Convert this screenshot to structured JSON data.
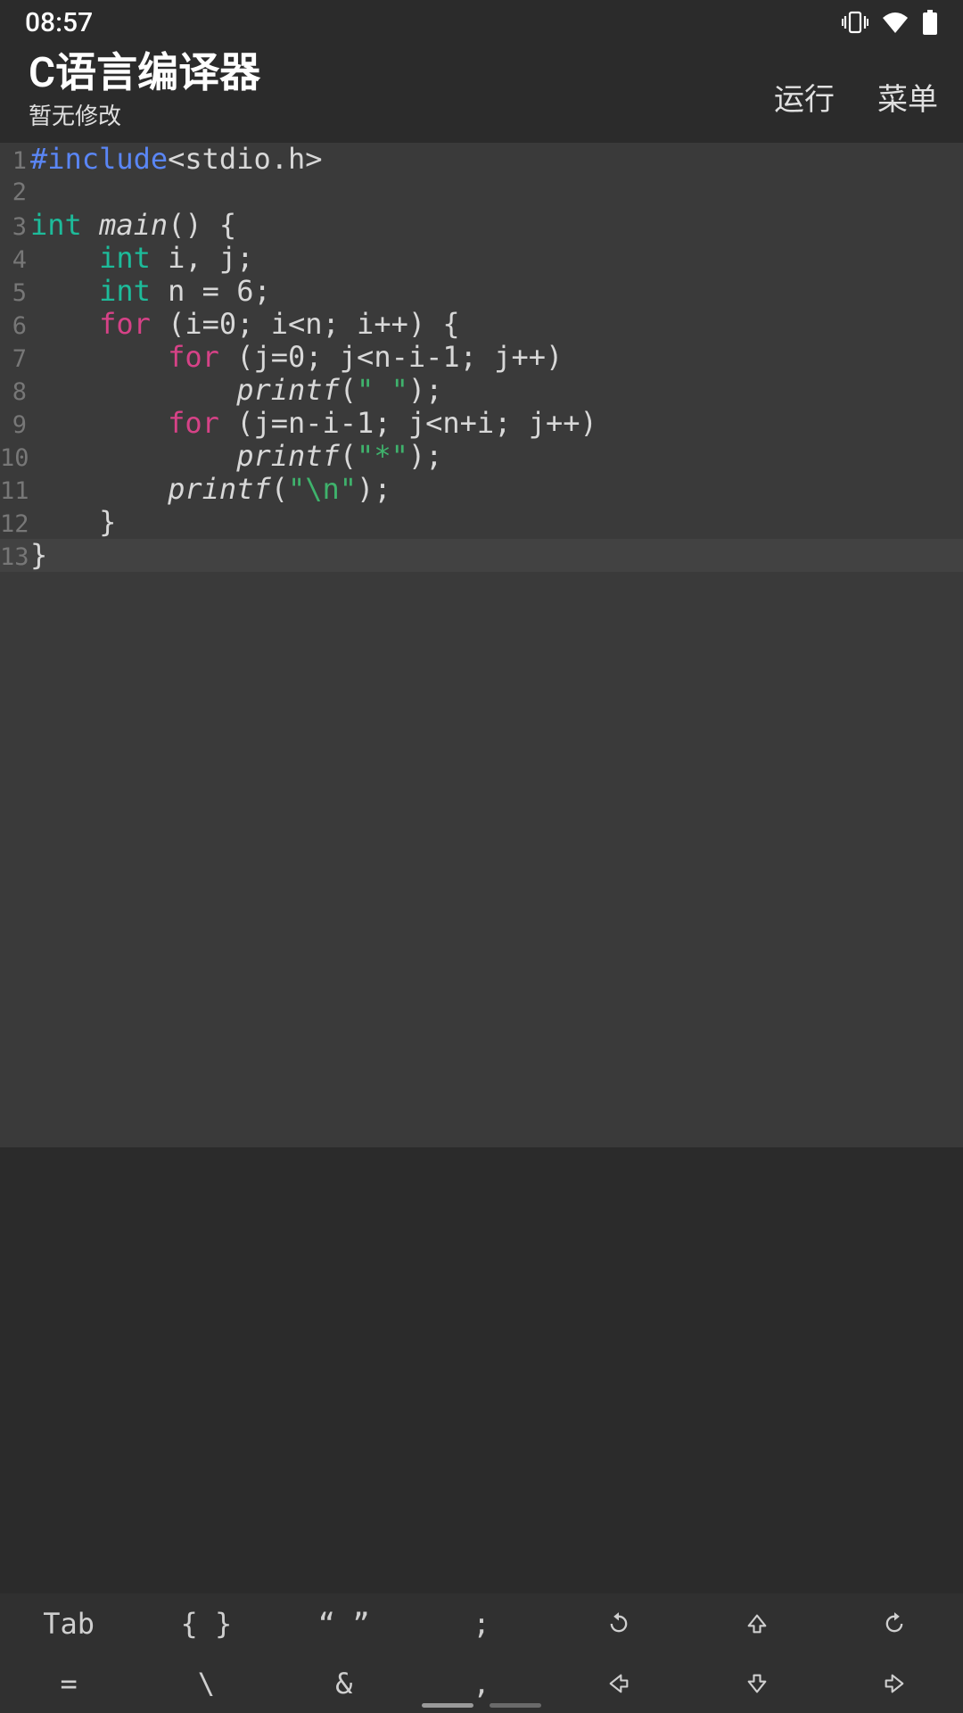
{
  "status": {
    "time": "08:57"
  },
  "header": {
    "title": "C语言编译器",
    "subtitle": "暂无修改",
    "run": "运行",
    "menu": "菜单"
  },
  "code": {
    "lines": [
      {
        "n": "1",
        "tokens": [
          {
            "c": "tok-preproc",
            "t": "#include"
          },
          {
            "c": "",
            "t": "<stdio.h>"
          }
        ]
      },
      {
        "n": "2",
        "tokens": []
      },
      {
        "n": "3",
        "tokens": [
          {
            "c": "tok-type",
            "t": "int"
          },
          {
            "c": "",
            "t": " "
          },
          {
            "c": "tok-ident",
            "t": "main"
          },
          {
            "c": "",
            "t": "() {"
          }
        ]
      },
      {
        "n": "4",
        "tokens": [
          {
            "c": "",
            "t": "    "
          },
          {
            "c": "tok-type",
            "t": "int"
          },
          {
            "c": "",
            "t": " i, j;"
          }
        ]
      },
      {
        "n": "5",
        "tokens": [
          {
            "c": "",
            "t": "    "
          },
          {
            "c": "tok-type",
            "t": "int"
          },
          {
            "c": "",
            "t": " n = 6;"
          }
        ]
      },
      {
        "n": "6",
        "tokens": [
          {
            "c": "",
            "t": "    "
          },
          {
            "c": "tok-kw",
            "t": "for"
          },
          {
            "c": "",
            "t": " (i=0; i<n; i++) {"
          }
        ]
      },
      {
        "n": "7",
        "tokens": [
          {
            "c": "",
            "t": "        "
          },
          {
            "c": "tok-kw",
            "t": "for"
          },
          {
            "c": "",
            "t": " (j=0; j<n-i-1; j++)"
          }
        ]
      },
      {
        "n": "8",
        "tokens": [
          {
            "c": "",
            "t": "            "
          },
          {
            "c": "tok-ident",
            "t": "printf"
          },
          {
            "c": "",
            "t": "("
          },
          {
            "c": "tok-str",
            "t": "\" \""
          },
          {
            "c": "",
            "t": ");"
          }
        ]
      },
      {
        "n": "9",
        "tokens": [
          {
            "c": "",
            "t": "        "
          },
          {
            "c": "tok-kw",
            "t": "for"
          },
          {
            "c": "",
            "t": " (j=n-i-1; j<n+i; j++)"
          }
        ]
      },
      {
        "n": "10",
        "tokens": [
          {
            "c": "",
            "t": "            "
          },
          {
            "c": "tok-ident",
            "t": "printf"
          },
          {
            "c": "",
            "t": "("
          },
          {
            "c": "tok-str",
            "t": "\"*\""
          },
          {
            "c": "",
            "t": ");"
          }
        ]
      },
      {
        "n": "11",
        "tokens": [
          {
            "c": "",
            "t": "        "
          },
          {
            "c": "tok-ident",
            "t": "printf"
          },
          {
            "c": "",
            "t": "("
          },
          {
            "c": "tok-str",
            "t": "\""
          },
          {
            "c": "tok-esc",
            "t": "\\n"
          },
          {
            "c": "tok-str",
            "t": "\""
          },
          {
            "c": "",
            "t": ");"
          }
        ]
      },
      {
        "n": "12",
        "tokens": [
          {
            "c": "",
            "t": "    }"
          }
        ]
      },
      {
        "n": "13",
        "tokens": [
          {
            "c": "",
            "t": "}"
          }
        ],
        "current": true
      }
    ]
  },
  "toolbar": {
    "row1": [
      "Tab",
      "{ }",
      "“ ”",
      ";",
      "↺",
      "⇧",
      "↻"
    ],
    "row2": [
      "=",
      "\\",
      "&",
      ",",
      "⇦",
      "⇩",
      "⇨"
    ]
  }
}
